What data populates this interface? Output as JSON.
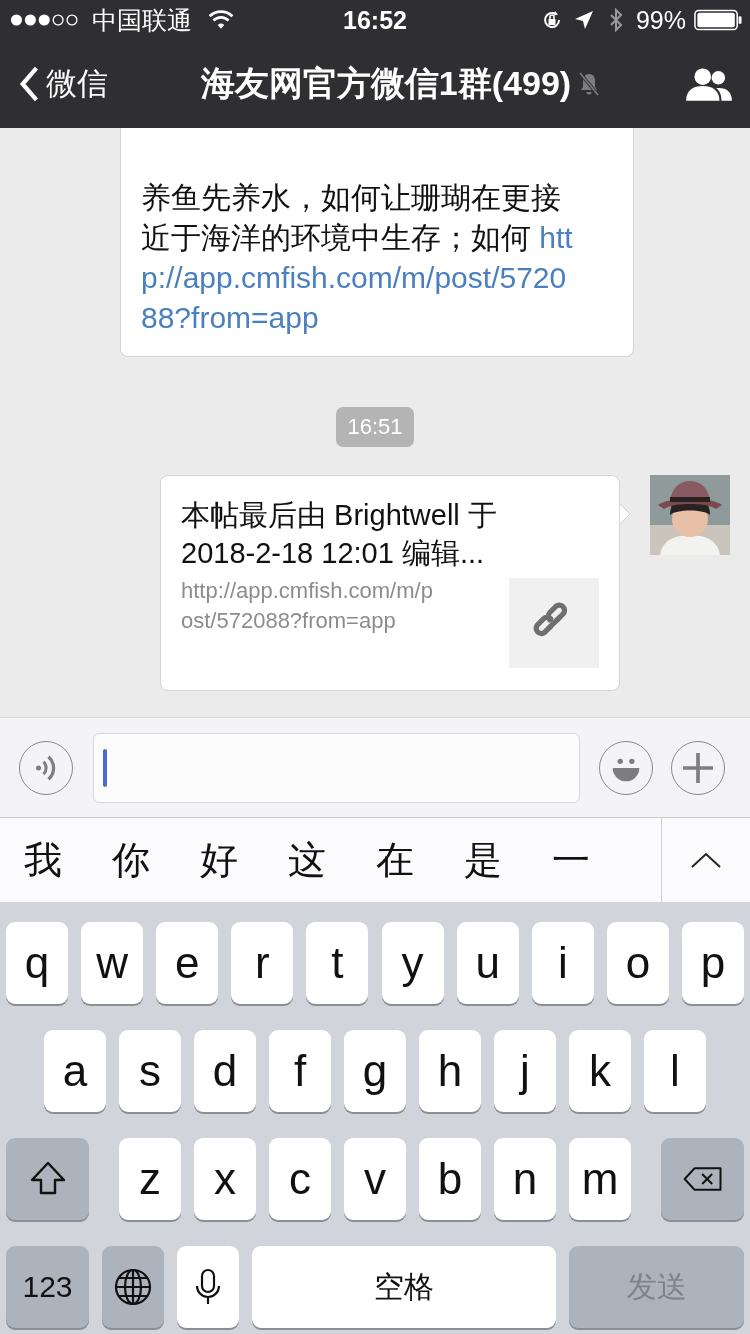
{
  "status_bar": {
    "carrier": "中国联通",
    "time": "16:52",
    "battery": "99%"
  },
  "nav": {
    "back_label": "微信",
    "title": "海友网官方微信1群(499)",
    "muted": true
  },
  "messages": [
    {
      "kind": "text",
      "text": "养鱼先养水，如何让珊瑚在更接近于海洋的环境中生存；如何 ",
      "link": "http://app.cmfish.com/m/post/572088?from=app"
    },
    {
      "kind": "timestamp",
      "text": "16:51"
    },
    {
      "kind": "link_card",
      "title": "本帖最后由 Brightwell 于 2018-2-18 12:01 编辑...",
      "url": "http://app.cmfish.com/m/post/572088?from=app"
    }
  ],
  "input": {
    "focused": true
  },
  "candidates": [
    "我",
    "你",
    "好",
    "这",
    "在",
    "是",
    "一"
  ],
  "keyboard": {
    "rows": [
      [
        {
          "kind": "letter",
          "label": "q"
        },
        {
          "kind": "letter",
          "label": "w"
        },
        {
          "kind": "letter",
          "label": "e"
        },
        {
          "kind": "letter",
          "label": "r"
        },
        {
          "kind": "letter",
          "label": "t"
        },
        {
          "kind": "letter",
          "label": "y"
        },
        {
          "kind": "letter",
          "label": "u"
        },
        {
          "kind": "letter",
          "label": "i"
        },
        {
          "kind": "letter",
          "label": "o"
        },
        {
          "kind": "letter",
          "label": "p"
        }
      ],
      [
        {
          "kind": "letter",
          "label": "a"
        },
        {
          "kind": "letter",
          "label": "s"
        },
        {
          "kind": "letter",
          "label": "d"
        },
        {
          "kind": "letter",
          "label": "f"
        },
        {
          "kind": "letter",
          "label": "g"
        },
        {
          "kind": "letter",
          "label": "h"
        },
        {
          "kind": "letter",
          "label": "j"
        },
        {
          "kind": "letter",
          "label": "k"
        },
        {
          "kind": "letter",
          "label": "l"
        }
      ],
      [
        {
          "kind": "shift"
        },
        {
          "kind": "letter",
          "label": "z"
        },
        {
          "kind": "letter",
          "label": "x"
        },
        {
          "kind": "letter",
          "label": "c"
        },
        {
          "kind": "letter",
          "label": "v"
        },
        {
          "kind": "letter",
          "label": "b"
        },
        {
          "kind": "letter",
          "label": "n"
        },
        {
          "kind": "letter",
          "label": "m"
        },
        {
          "kind": "delete"
        }
      ]
    ],
    "bottom_row": [
      {
        "kind": "numbers",
        "label": "123"
      },
      {
        "kind": "globe"
      },
      {
        "kind": "mic"
      },
      {
        "kind": "space",
        "label": "空格"
      },
      {
        "kind": "send",
        "label": "发送",
        "disabled": true
      }
    ]
  }
}
